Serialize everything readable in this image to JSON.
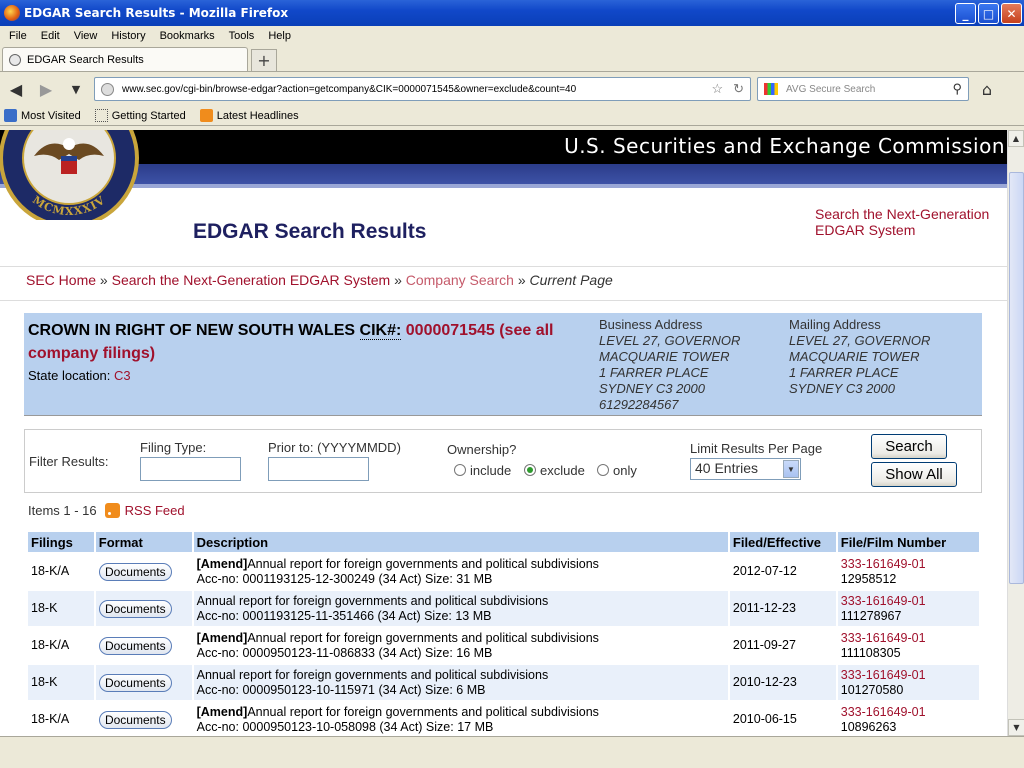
{
  "window": {
    "title": "EDGAR Search Results - Mozilla Firefox",
    "buttons": [
      "_",
      "□",
      "✕"
    ]
  },
  "menu": [
    "File",
    "Edit",
    "View",
    "History",
    "Bookmarks",
    "Tools",
    "Help"
  ],
  "tab": {
    "title": "EDGAR Search Results",
    "new_tab": "+"
  },
  "nav": {
    "url": "www.sec.gov/cgi-bin/browse-edgar?action=getcompany&CIK=0000071545&owner=exclude&count=40",
    "search_placeholder": "AVG Secure Search"
  },
  "bookmarks": [
    "Most Visited",
    "Getting Started",
    "Latest Headlines"
  ],
  "sec": {
    "banner_title": "U.S. Securities and Exchange Commission",
    "seal_text": "MCMXXXIV",
    "page_title": "EDGAR Search Results",
    "nextgen_line1": "Search the Next-Generation",
    "nextgen_line2": "EDGAR System"
  },
  "breadcrumb": {
    "home": "SEC Home",
    "sep": "»",
    "nextgen": "Search the Next-Generation EDGAR System",
    "company_search": "Company Search",
    "current": "Current Page"
  },
  "company": {
    "name": "CROWN IN RIGHT OF NEW SOUTH WALES",
    "cik_label": "CIK#:",
    "cik": "0000071545",
    "see_all": "(see all company filings)",
    "state_label": "State location:",
    "state": "C3",
    "business_address": {
      "label": "Business Address",
      "lines": [
        "LEVEL 27, GOVERNOR",
        "MACQUARIE TOWER",
        "1 FARRER PLACE",
        "SYDNEY C3 2000",
        "61292284567"
      ]
    },
    "mailing_address": {
      "label": "Mailing Address",
      "lines": [
        "LEVEL 27, GOVERNOR",
        "MACQUARIE TOWER",
        "1 FARRER PLACE",
        "SYDNEY C3 2000"
      ]
    }
  },
  "filter": {
    "label": "Filter Results:",
    "filing_type_label": "Filing Type:",
    "filing_type_value": "",
    "prior_to_label": "Prior to: (YYYYMMDD)",
    "prior_to_value": "",
    "ownership_label": "Ownership?",
    "ownership_options": [
      "include",
      "exclude",
      "only"
    ],
    "ownership_selected": "exclude",
    "limit_label": "Limit Results Per Page",
    "limit_value": "40 Entries",
    "search_button": "Search",
    "show_all_button": "Show All"
  },
  "results": {
    "items_text": "Items 1 - 16",
    "rss": "RSS Feed",
    "headers": [
      "Filings",
      "Format",
      "Description",
      "Filed/Effective",
      "File/Film Number"
    ],
    "rows": [
      {
        "filing": "18-K/A",
        "format": "Documents",
        "amend": "[Amend]",
        "desc": "Annual report for foreign governments and political subdivisions",
        "acc": "Acc-no: 0001193125-12-300249 (34 Act)  Size: 31 MB",
        "date": "2012-07-12",
        "file": "333-161649-01",
        "film": "12958512"
      },
      {
        "filing": "18-K",
        "format": "Documents",
        "amend": "",
        "desc": "Annual report for foreign governments and political subdivisions",
        "acc": "Acc-no: 0001193125-11-351466 (34 Act)  Size: 13 MB",
        "date": "2011-12-23",
        "file": "333-161649-01",
        "film": "111278967"
      },
      {
        "filing": "18-K/A",
        "format": "Documents",
        "amend": "[Amend]",
        "desc": "Annual report for foreign governments and political subdivisions",
        "acc": "Acc-no: 0000950123-11-086833 (34 Act)  Size: 16 MB",
        "date": "2011-09-27",
        "file": "333-161649-01",
        "film": "111108305"
      },
      {
        "filing": "18-K",
        "format": "Documents",
        "amend": "",
        "desc": "Annual report for foreign governments and political subdivisions",
        "acc": "Acc-no: 0000950123-10-115971 (34 Act)  Size: 6 MB",
        "date": "2010-12-23",
        "file": "333-161649-01",
        "film": "101270580"
      },
      {
        "filing": "18-K/A",
        "format": "Documents",
        "amend": "[Amend]",
        "desc": "Annual report for foreign governments and political subdivisions",
        "acc": "Acc-no: 0000950123-10-058098 (34 Act)  Size: 17 MB",
        "date": "2010-06-15",
        "file": "333-161649-01",
        "film": "10896263"
      }
    ]
  }
}
